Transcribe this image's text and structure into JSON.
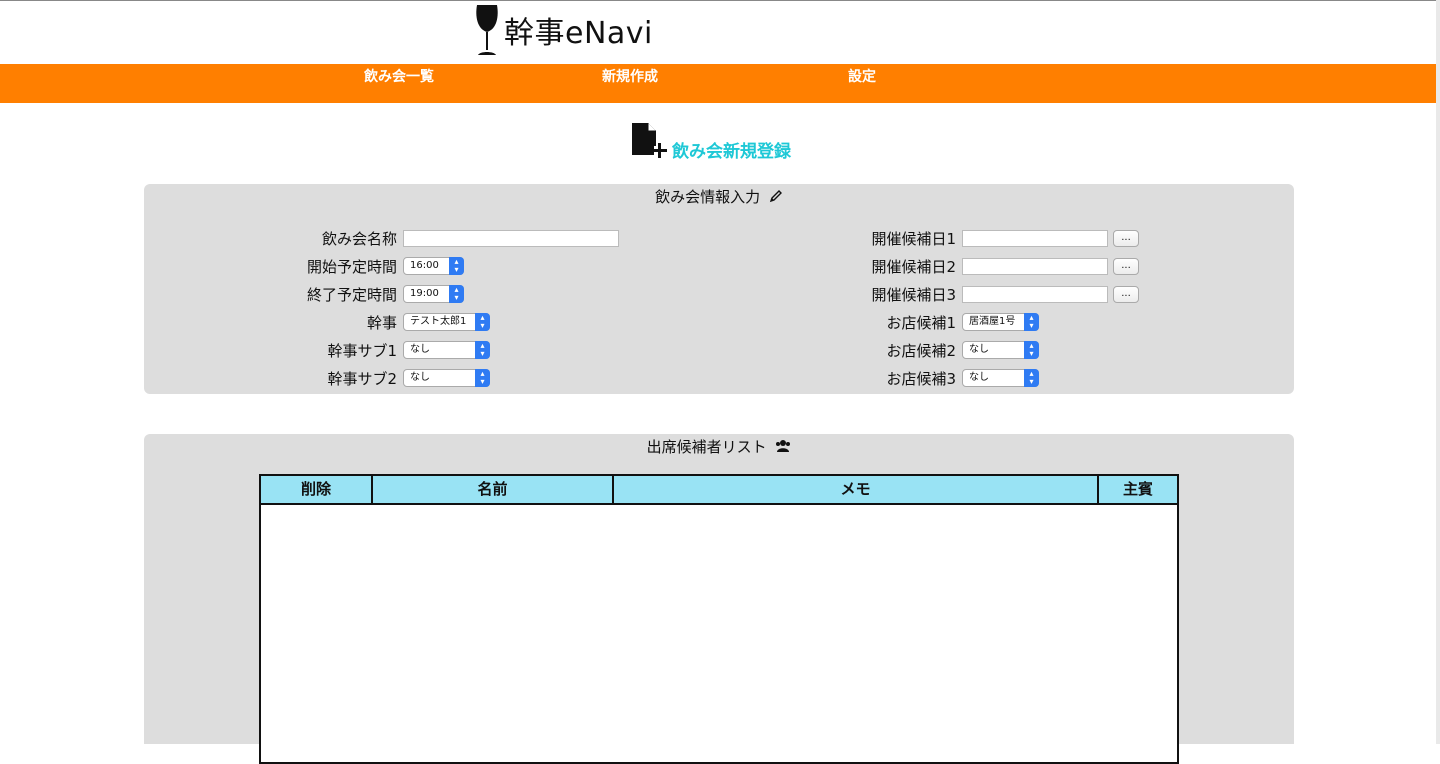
{
  "brand": {
    "name": "幹事eNavi"
  },
  "nav": {
    "items": [
      {
        "label": "飲み会一覧"
      },
      {
        "label": "新規作成"
      },
      {
        "label": "設定"
      }
    ]
  },
  "colors": {
    "nav_bg": "#ff7f00",
    "title_accent": "#1ec8d6",
    "panel_bg": "#dddddd",
    "table_header_bg": "#99e3f4",
    "select_arrow": "#2f7bf3"
  },
  "page": {
    "title": "飲み会新規登録",
    "title_icon": "file-add-icon"
  },
  "info_panel": {
    "heading": "飲み会情報入力",
    "heading_icon": "pencil-icon",
    "left_fields": {
      "name_label": "飲み会名称",
      "name_value": "",
      "start_label": "開始予定時間",
      "start_value": "16:00",
      "end_label": "終了予定時間",
      "end_value": "19:00",
      "organizer_label": "幹事",
      "organizer_value": "テスト太郎1",
      "sub1_label": "幹事サブ1",
      "sub1_value": "なし",
      "sub2_label": "幹事サブ2",
      "sub2_value": "なし"
    },
    "right_fields": {
      "date1_label": "開催候補日1",
      "date1_value": "",
      "date2_label": "開催候補日2",
      "date2_value": "",
      "date3_label": "開催候補日3",
      "date3_value": "",
      "picker_label": "...",
      "shop1_label": "お店候補1",
      "shop1_value": "居酒屋1号",
      "shop2_label": "お店候補2",
      "shop2_value": "なし",
      "shop3_label": "お店候補3",
      "shop3_value": "なし"
    }
  },
  "attendee_panel": {
    "heading": "出席候補者リスト",
    "heading_icon": "users-icon",
    "columns": [
      "削除",
      "名前",
      "メモ",
      "主賓"
    ],
    "rows": []
  }
}
